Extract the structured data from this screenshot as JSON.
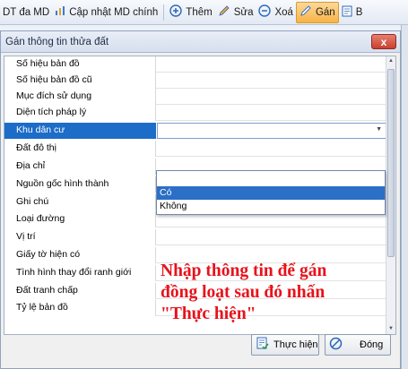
{
  "toolbar": {
    "items": [
      {
        "label": "DT đa MD",
        "icon": "dt-icon"
      },
      {
        "label": "Cập nhật MD chính",
        "icon": "update-icon"
      },
      {
        "label": "Thêm",
        "icon": "plus-icon"
      },
      {
        "label": "Sửa",
        "icon": "pencil-icon"
      },
      {
        "label": "Xoá",
        "icon": "minus-icon"
      },
      {
        "label": "Gán",
        "icon": "pencil-icon"
      },
      {
        "label": "B",
        "icon": "doc-icon"
      }
    ]
  },
  "dialog": {
    "title": "Gán thông tin thửa đất",
    "close_label": "x",
    "rows": [
      {
        "label": "Số hiệu bản đồ",
        "value": ""
      },
      {
        "label": "Số hiệu bản đồ cũ",
        "value": ""
      },
      {
        "label": "Mục đích sử dụng",
        "value": ""
      },
      {
        "label": "Diện tích pháp lý",
        "value": ""
      },
      {
        "label": "Khu dân cư",
        "value": ""
      },
      {
        "label": "Đất đô thị",
        "value": ""
      },
      {
        "label": "Địa chỉ",
        "value": ""
      },
      {
        "label": "Nguồn gốc hình thành",
        "value": ""
      },
      {
        "label": "Ghi chú",
        "value": ""
      },
      {
        "label": "Loại đường",
        "value": ""
      },
      {
        "label": "Vị trí",
        "value": ""
      },
      {
        "label": "Giấy tờ hiện có",
        "value": ""
      },
      {
        "label": "Tình hình thay đổi ranh giới",
        "value": ""
      },
      {
        "label": "Đất tranh chấp",
        "value": ""
      },
      {
        "label": "Tỷ lệ bản đồ",
        "value": ""
      }
    ],
    "dropdown_options": [
      "",
      "Có",
      "Không"
    ],
    "annotation": "Nhập thông tin để gán đồng loạt sau đó nhấn \"Thực hiện\"",
    "buttons": {
      "execute": "Thực hiện",
      "close": "Đóng"
    }
  }
}
